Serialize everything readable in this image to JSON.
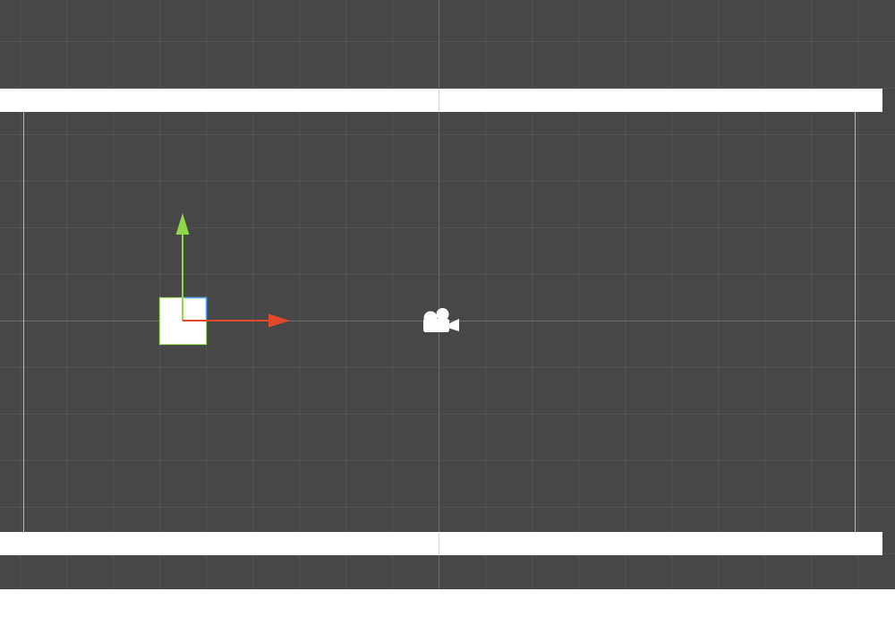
{
  "scene": {
    "background_color": "#474747",
    "grid_minor_color": "#545454",
    "grid_axis_color": "#6e6e6e",
    "camera_bounds_color": "#b8b8b8",
    "wall_color": "#ffffff",
    "walls": [
      {
        "name": "top-wall"
      },
      {
        "name": "bottom-wall"
      }
    ],
    "selected_object": {
      "name": "square-sprite",
      "fill_color": "#ffffff",
      "outline_color": "#a8e06a",
      "corner_color": "#5aa8ff"
    },
    "move_gizmo": {
      "y_axis_color": "#8ed84a",
      "x_axis_color": "#e04a2a"
    },
    "camera_gizmo": {
      "icon": "camera-icon",
      "color": "#ffffff"
    }
  },
  "page": {
    "bottom_background": "#ffffff"
  }
}
